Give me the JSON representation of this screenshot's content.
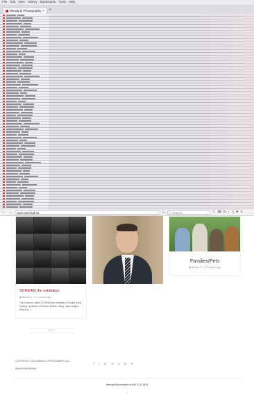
{
  "menubar": {
    "items": [
      "File",
      "Edit",
      "View",
      "History",
      "Bookmarks",
      "Tools",
      "Help"
    ]
  },
  "tab": {
    "title": "Wendy D Photography - Vic...",
    "close": "×",
    "new_tab": "+"
  },
  "navbar": {
    "back": "←",
    "forward": "→",
    "url": "www.wendyd.ca",
    "reload": "C",
    "search_placeholder": "Search"
  },
  "posts": [
    {
      "title": "SCREAM the exhibition",
      "author": "Wendy D.",
      "date": "2 months ago",
      "excerpt": "The Overture called SCREAM the exhibition 20 years in the making, hundreds of scream photos, many, many laughs (Espoir)[...]"
    },
    {
      "title": "Families/Pets",
      "author": "Wendy D.",
      "date": "2 months ago"
    }
  ],
  "load_more": "• • •",
  "footer": {
    "copyright": "COPYRIGHT © 2014 WENDY D PHOTOGRAPHY. ALL",
    "rights": "RIGHTS RESERVED",
    "social": [
      "f",
      "t",
      "g+",
      "in",
      "p",
      "yt",
      "✉"
    ],
    "contact": "WendyD@wendyd.ca  604 703 1401",
    "top_button": "^"
  }
}
